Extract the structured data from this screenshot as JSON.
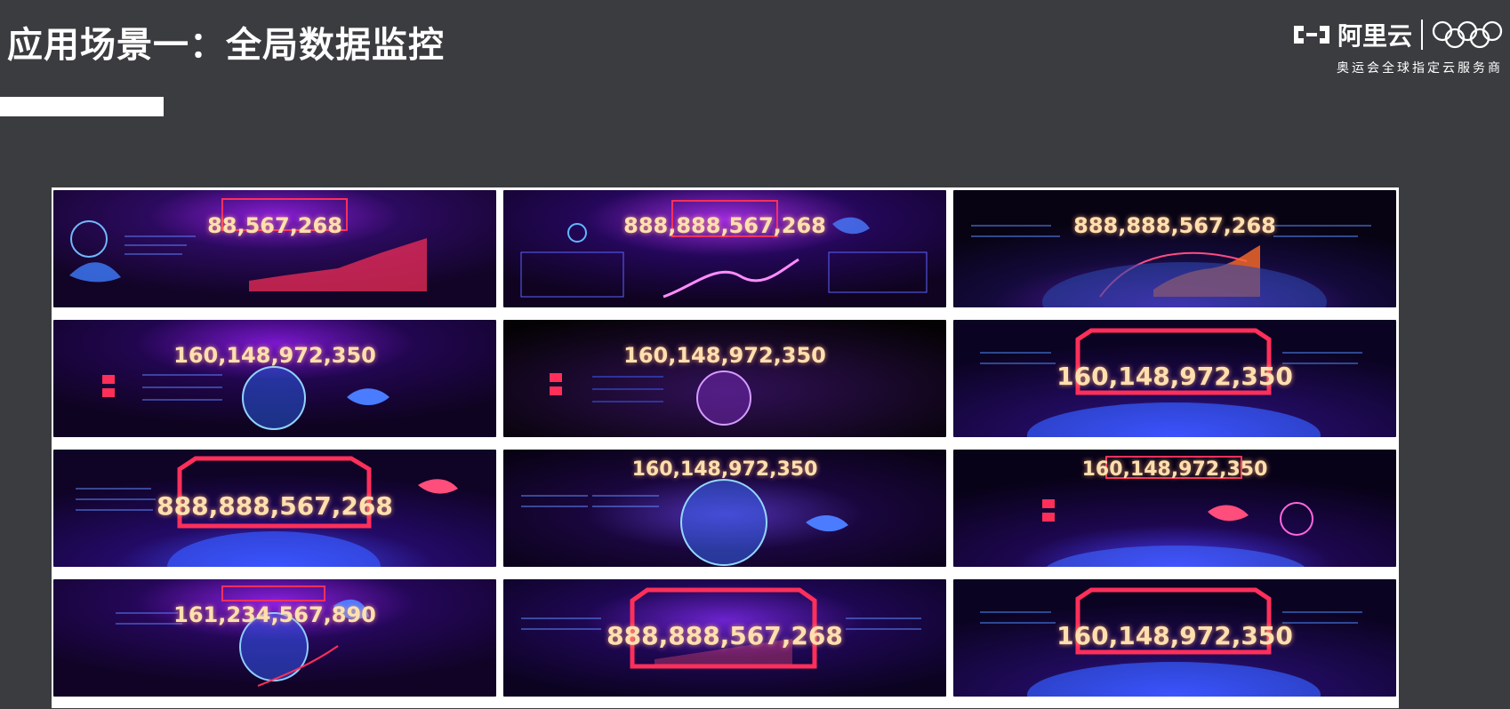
{
  "slide": {
    "title": "应用场景一：全局数据监控"
  },
  "brand": {
    "name": "阿里云",
    "tagline": "奥运会全球指定云服务商"
  },
  "panels": [
    {
      "value": "88,567,268",
      "style": "small"
    },
    {
      "value": "888,888,567,268",
      "style": "small"
    },
    {
      "value": "888,888,567,268",
      "style": "small"
    },
    {
      "value": "160,148,972,350",
      "style": "small"
    },
    {
      "value": "160,148,972,350",
      "style": "small"
    },
    {
      "value": "160,148,972,350",
      "style": "large"
    },
    {
      "value": "888,888,567,268",
      "style": "large"
    },
    {
      "value": "160,148,972,350",
      "style": "top"
    },
    {
      "value": "160,148,972,350",
      "style": "small"
    },
    {
      "value": "161,234,567,890",
      "style": "small"
    },
    {
      "value": "888,888,567,268",
      "style": "large"
    },
    {
      "value": "160,148,972,350",
      "style": "large"
    }
  ],
  "colors": {
    "slide_background": "#3a3c3f",
    "mosaic_background": "#ffffff",
    "panel_base": "#120427",
    "panel_glow": "#8a1dd6",
    "accent_red": "#ff2f5a",
    "number_gold": "#ffe0ae"
  }
}
